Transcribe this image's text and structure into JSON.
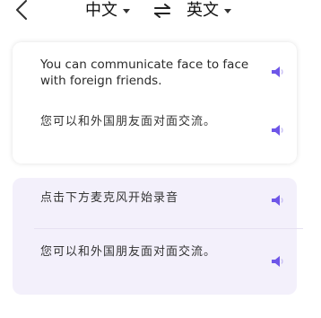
{
  "header": {
    "source_language": "中文",
    "target_language": "英文",
    "back_icon": "chevron-left-icon",
    "swap_icon": "swap-arrows-icon"
  },
  "conversation": [
    {
      "bubble": "white",
      "original": "You can communicate face to face with foreign friends.",
      "translation": "您可以和外国朋友面对面交流。"
    },
    {
      "bubble": "purple",
      "original": "点击下方麦克风开始录音",
      "translation": "您可以和外国朋友面对面交流。"
    }
  ],
  "colors": {
    "accent": "#6e56e8",
    "bubble_purple_bg": "#f3f0fb",
    "divider": "#e6e1f2"
  }
}
